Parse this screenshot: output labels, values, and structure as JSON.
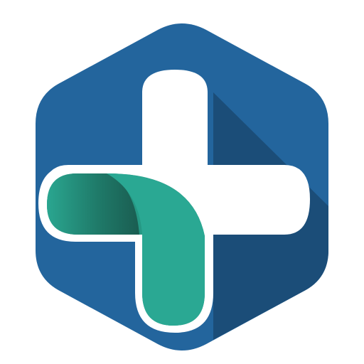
{
  "logo": {
    "name": "medical-cross-hexagon-logo",
    "colors": {
      "background": "#ffffff",
      "hexagon_blue": "#23659d",
      "hexagon_shadow": "#1b4d78",
      "cross_white": "#ffffff",
      "ribbon_teal": "#27a08c",
      "ribbon_dark_teal": "#1f6a5b"
    },
    "icon_names": [
      "hexagon-icon",
      "plus-cross-icon",
      "teal-ribbon-icon"
    ]
  }
}
